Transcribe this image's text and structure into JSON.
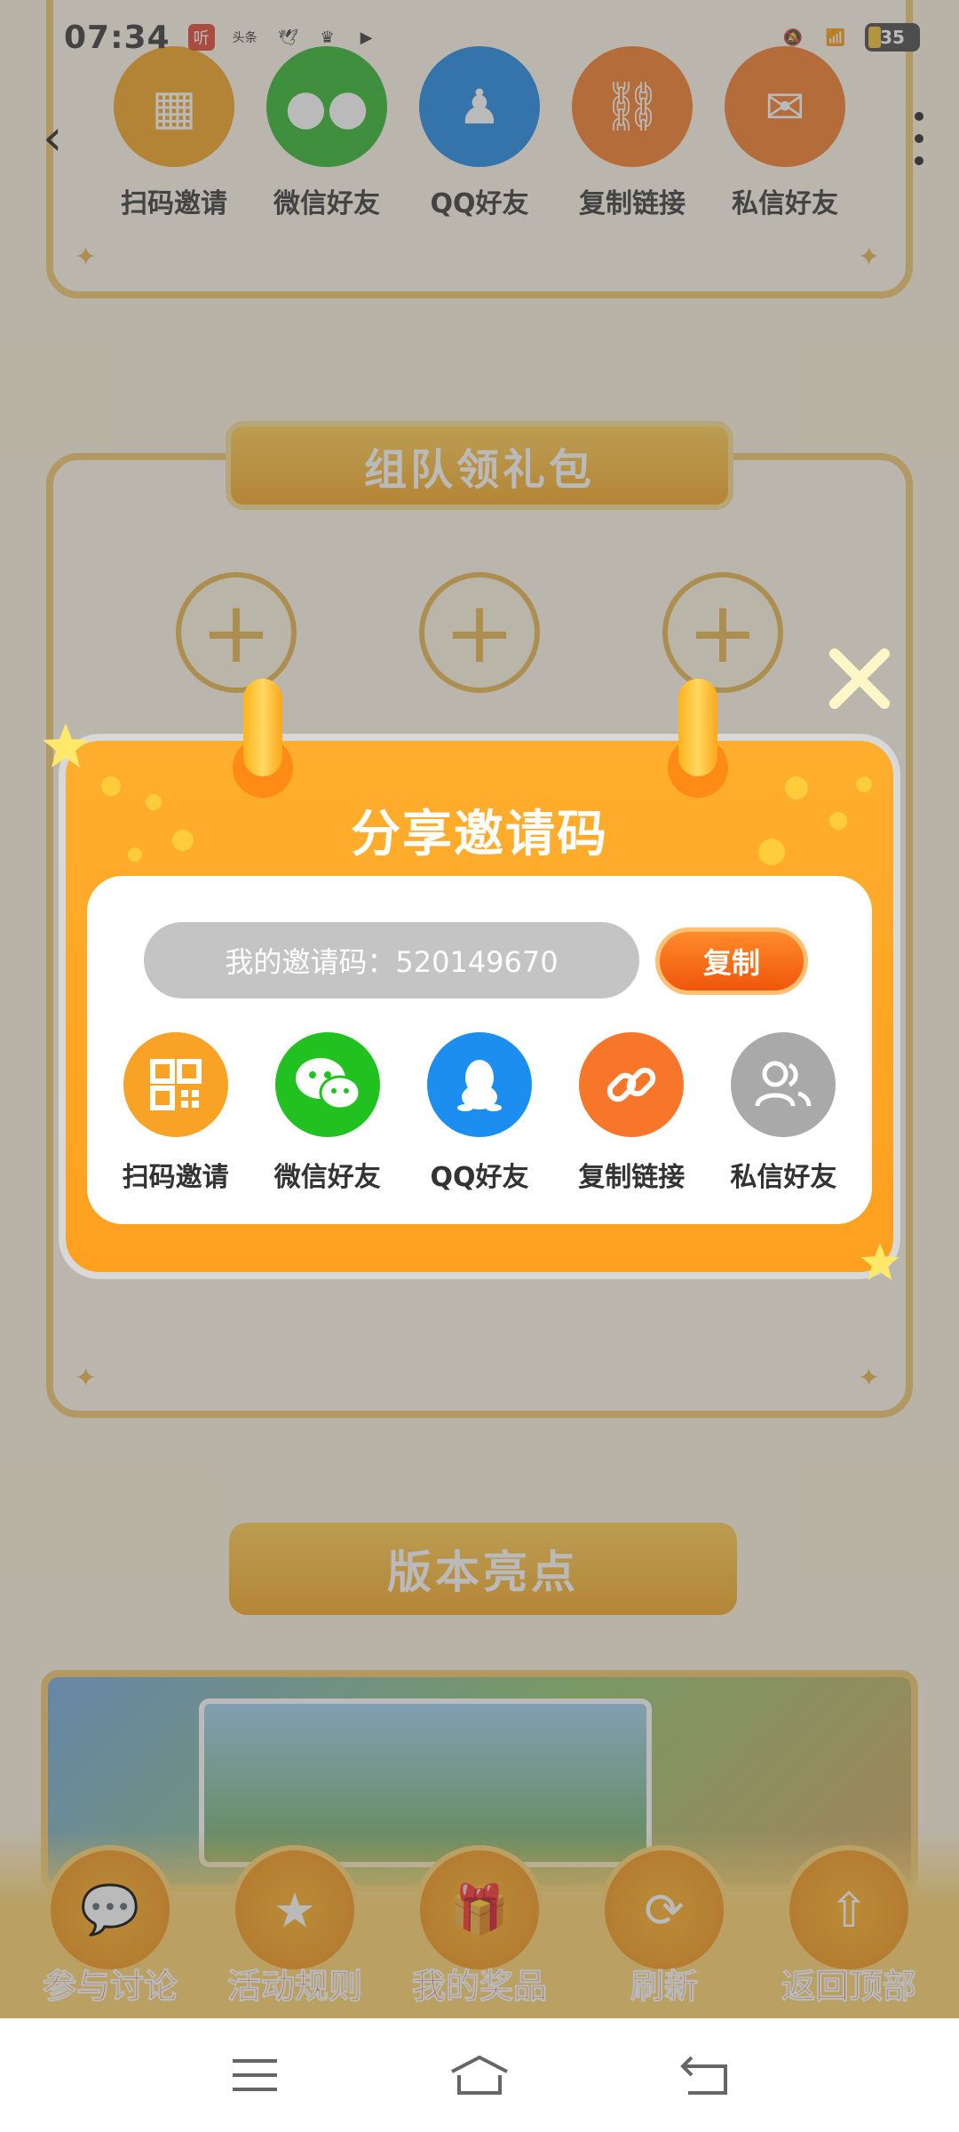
{
  "status_bar": {
    "time": "07:34",
    "app_icon_label": "听",
    "news_icon_label": "头条",
    "battery_level": "35"
  },
  "background": {
    "share_row": [
      {
        "label": "扫码邀请",
        "icon": "qr-code-icon",
        "color": "#f4a21d"
      },
      {
        "label": "微信好友",
        "icon": "wechat-icon",
        "color": "#2bb52a"
      },
      {
        "label": "QQ好友",
        "icon": "qq-icon",
        "color": "#1a86e6"
      },
      {
        "label": "复制链接",
        "icon": "link-icon",
        "color": "#f47a24"
      },
      {
        "label": "私信好友",
        "icon": "mail-icon",
        "color": "#f47a24"
      }
    ],
    "team_banner": "组队领礼包",
    "highlights_banner": "版本亮点",
    "bottom_bar": [
      {
        "label": "参与讨论",
        "icon": "chat-icon"
      },
      {
        "label": "活动规则",
        "icon": "rules-icon"
      },
      {
        "label": "我的奖品",
        "icon": "gift-icon"
      },
      {
        "label": "刷新",
        "icon": "refresh-icon"
      },
      {
        "label": "返回顶部",
        "icon": "upload-icon"
      }
    ]
  },
  "modal": {
    "title": "分享邀请码",
    "invite_code_text": "我的邀请码：520149670",
    "copy_label": "复制",
    "share_options": [
      {
        "label": "扫码邀请",
        "icon": "qr-code-icon",
        "color": "#f8a325"
      },
      {
        "label": "微信好友",
        "icon": "wechat-icon",
        "color": "#21c11f"
      },
      {
        "label": "QQ好友",
        "icon": "qq-icon",
        "color": "#1b8ef0"
      },
      {
        "label": "复制链接",
        "icon": "link-icon",
        "color": "#f8762a"
      },
      {
        "label": "私信好友",
        "icon": "contacts-icon",
        "color": "#a9a9a9"
      }
    ]
  },
  "colors": {
    "modal_orange": "#ffa524",
    "copy_button": "#f5650f",
    "code_pill_gray": "#c4c4c4"
  }
}
